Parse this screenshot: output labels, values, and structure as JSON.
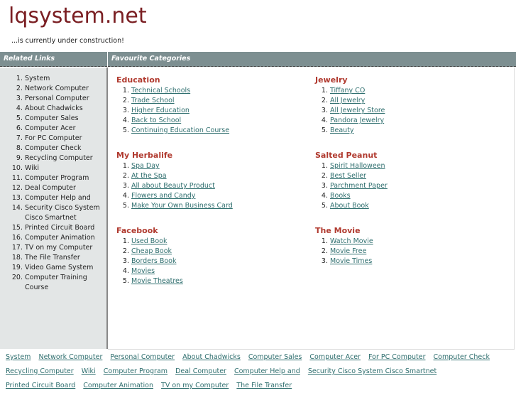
{
  "site": {
    "title": "lqsystem.net",
    "subtitle": "...is currently under construction!"
  },
  "sidebar": {
    "heading": "Related Links",
    "items": [
      "System",
      "Network Computer",
      "Personal Computer",
      "About Chadwicks",
      "Computer Sales",
      "Computer Acer",
      "For PC Computer",
      "Computer Check",
      "Recycling Computer",
      "Wiki",
      "Computer Program",
      "Deal Computer",
      "Computer Help and",
      "Security Cisco System Cisco Smartnet",
      "Printed Circuit Board",
      "Computer Animation",
      "TV on my Computer",
      "The File Transfer",
      "Video Game System",
      "Computer Training Course"
    ]
  },
  "main": {
    "heading": "Favourite Categories",
    "categories": [
      {
        "title": "Education",
        "links": [
          "Technical Schools",
          "Trade School",
          "Higher Education",
          "Back to School",
          "Continuing Education Course"
        ]
      },
      {
        "title": "Jewelry",
        "links": [
          "Tiffany CO",
          "All Jewelry",
          "All Jewelry Store",
          "Pandora Jewelry",
          "Beauty"
        ]
      },
      {
        "title": "My Herbalife",
        "links": [
          "Spa Day",
          "At the Spa",
          "All about Beauty Product",
          "Flowers and Candy",
          "Make Your Own Business Card"
        ]
      },
      {
        "title": "Salted Peanut",
        "links": [
          "Spirit Halloween",
          "Best Seller",
          "Parchment Paper",
          "Books",
          "About Book"
        ]
      },
      {
        "title": "Facebook",
        "links": [
          "Used Book",
          "Cheap Book",
          "Borders Book",
          "Movies",
          "Movie Theatres"
        ]
      },
      {
        "title": "The Movie",
        "links": [
          "Watch Movie",
          "Movie Free",
          "Movie Times"
        ]
      }
    ]
  },
  "footer": {
    "links": [
      "System",
      "Network Computer",
      "Personal Computer",
      "About Chadwicks",
      "Computer Sales",
      "Computer Acer",
      "For PC Computer",
      "Computer Check",
      "Recycling Computer",
      "Wiki",
      "Computer Program",
      "Deal Computer",
      "Computer Help and",
      "Security Cisco System Cisco Smartnet",
      "Printed Circuit Board",
      "Computer Animation",
      "TV on my Computer",
      "The File Transfer"
    ]
  }
}
